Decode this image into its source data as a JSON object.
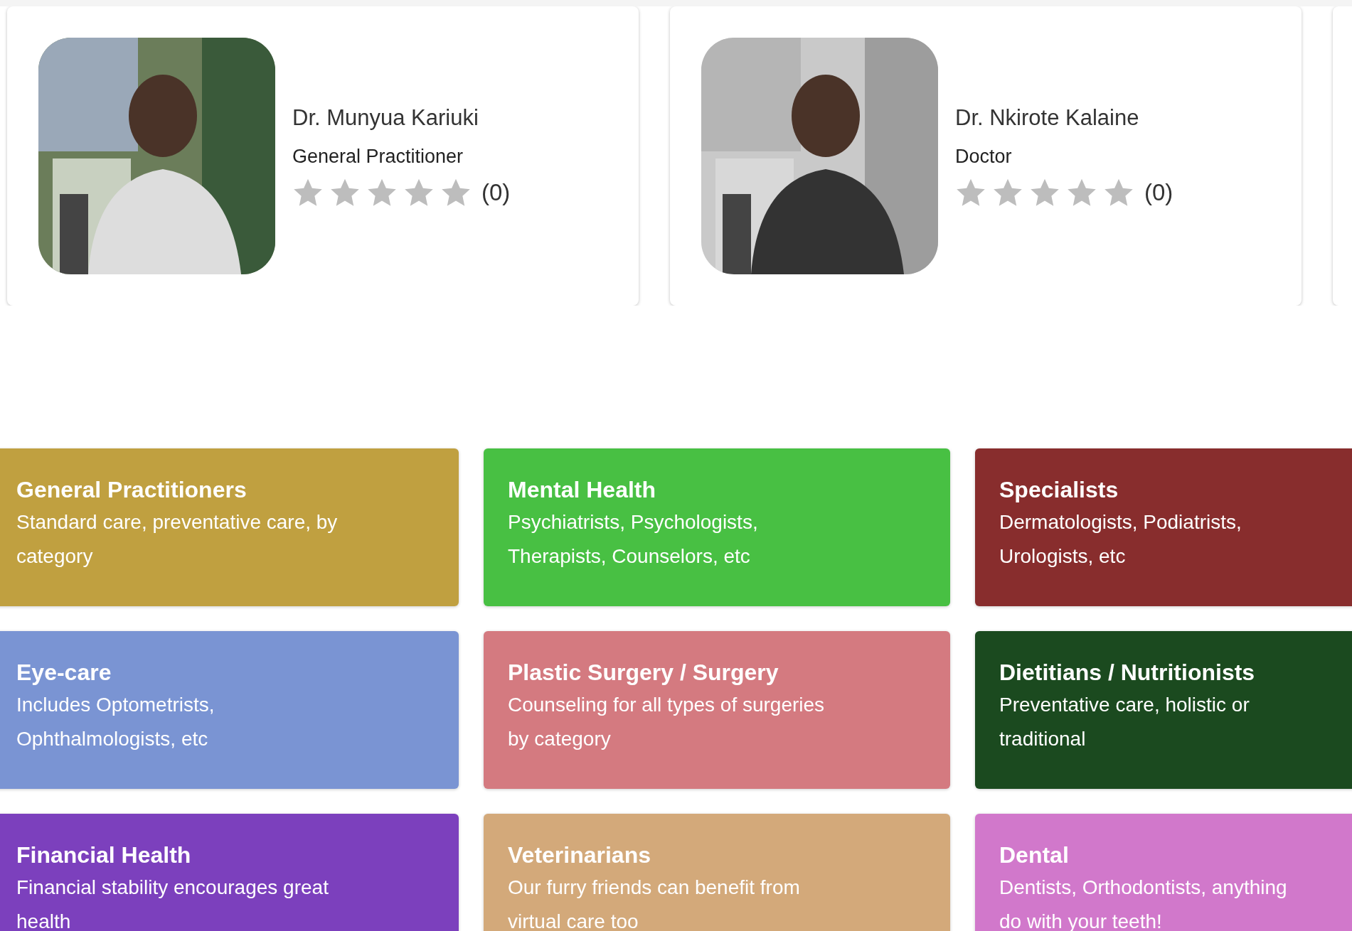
{
  "doctors": [
    {
      "name": "Dr. Munyua Kariuki",
      "specialty": "General Practitioner",
      "stars": 0,
      "reviews": "(0)"
    },
    {
      "name": "Dr. Nkirote Kalaine",
      "specialty": "Doctor",
      "stars": 0,
      "reviews": "(0)"
    }
  ],
  "categories": [
    {
      "title": "General Practitioners",
      "lines": [
        "Standard care, preventative care, by",
        "category"
      ],
      "color": "#c0a040"
    },
    {
      "title": "Mental Health",
      "lines": [
        "Psychiatrists, Psychologists,",
        "Therapists, Counselors, etc"
      ],
      "color": "#48c043"
    },
    {
      "title": "Specialists",
      "lines": [
        "Dermatologists, Podiatrists,",
        "Urologists, etc"
      ],
      "color": "#882d2d"
    },
    {
      "title": "Eye-care",
      "lines": [
        "Includes Optometrists,",
        "Ophthalmologists, etc"
      ],
      "color": "#7a94d3"
    },
    {
      "title": "Plastic Surgery / Surgery",
      "lines": [
        "Counseling for all types of surgeries",
        "by category"
      ],
      "color": "#d47a80"
    },
    {
      "title": "Dietitians / Nutritionists",
      "lines": [
        "Preventative care, holistic or",
        "traditional"
      ],
      "color": "#1b4a1f"
    },
    {
      "title": "Financial Health",
      "lines": [
        "Financial stability encourages great",
        "health"
      ],
      "color": "#7c40bd"
    },
    {
      "title": "Veterinarians",
      "lines": [
        "Our furry friends can benefit from",
        "virtual care too"
      ],
      "color": "#d3a97a"
    },
    {
      "title": "Dental",
      "lines": [
        "Dentists, Orthodontists, anything",
        "do with your teeth!"
      ],
      "color": "#d178cb"
    }
  ]
}
